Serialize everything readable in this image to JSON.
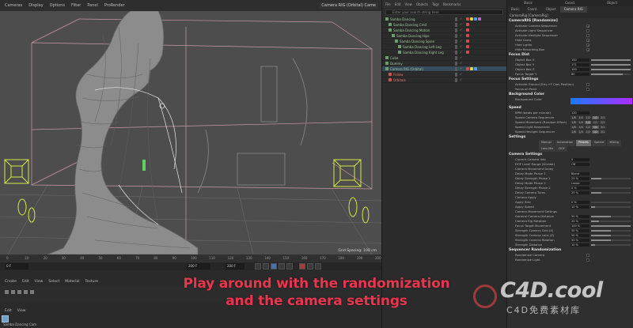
{
  "viewport": {
    "menus": [
      "Cameras",
      "Display",
      "Options",
      "Filter",
      "Panel",
      "ProRender"
    ],
    "camera_label": "Camera RIG (Orbital) Came",
    "footer": "Grid Spacing: 100 cm"
  },
  "timeline": {
    "ticks": [
      "0",
      "10",
      "20",
      "30",
      "40",
      "50",
      "60",
      "70",
      "80",
      "90",
      "100",
      "110",
      "120",
      "130",
      "140",
      "150",
      "160",
      "170",
      "180",
      "190",
      "200"
    ],
    "frame_start": "0 F",
    "frame_end": "200 F",
    "frame_total": "200 F",
    "material_menus": [
      "Create",
      "Edit",
      "View",
      "Select",
      "Material",
      "Texture"
    ],
    "attr_menus": [
      "Edit",
      "View"
    ],
    "material_name": "Samba Dancing Cam"
  },
  "object_manager": {
    "header": [
      "File",
      "Edit",
      "View",
      "Objects",
      "Tags",
      "Bookmarks"
    ],
    "search_placeholder": "Enter your search string here",
    "rows": [
      {
        "label": "Samba Dancing",
        "indent": 0,
        "selected": false,
        "red": false
      },
      {
        "label": "Samba Dancing Cmd",
        "indent": 1,
        "selected": false,
        "red": false
      },
      {
        "label": "Samba Dancing Motion",
        "indent": 1,
        "selected": false,
        "red": false
      },
      {
        "label": "Samba Dancing Hips",
        "indent": 2,
        "selected": false,
        "red": false
      },
      {
        "label": "Samba Dancing Spine",
        "indent": 3,
        "selected": false,
        "red": false
      },
      {
        "label": "Samba Dancing Left Leg",
        "indent": 4,
        "selected": false,
        "red": false
      },
      {
        "label": "Samba Dancing Right Leg",
        "indent": 4,
        "selected": false,
        "red": false
      },
      {
        "label": "Cube",
        "indent": 0,
        "selected": false,
        "red": false
      },
      {
        "label": "Dummy",
        "indent": 0,
        "selected": false,
        "red": false
      },
      {
        "label": "Camera RIG (Orbital)",
        "indent": 0,
        "selected": true,
        "red": false
      },
      {
        "label": "Follow",
        "indent": 1,
        "selected": false,
        "red": true
      },
      {
        "label": "Orbitals",
        "indent": 1,
        "selected": false,
        "red": true
      }
    ]
  },
  "attribute_manager": {
    "tabs": [
      "Basic",
      "Coord.",
      "Object"
    ],
    "tabs2": [
      "Basic",
      "Coord.",
      "Object",
      "Camera RIG"
    ],
    "object_name": "CameraRig [CameraRig]",
    "sections": {
      "randomize": "CameraRIG [Randomize]",
      "focus": "Focus Dist",
      "focus_settings": "Focus Settings",
      "background": "Background Color",
      "speed": "Speed",
      "settings": "Settings"
    },
    "randomize_rows": [
      {
        "k": "Activate Camera Sequencer",
        "check": "✓"
      },
      {
        "k": "Activate Light Sequencer",
        "check": ""
      },
      {
        "k": "Activate Hexlight Sequencer",
        "check": ""
      },
      {
        "k": "Hide Cams",
        "check": "✓"
      },
      {
        "k": "Hide Lights",
        "check": "✓"
      },
      {
        "k": "Hide Recording Box",
        "check": "✓"
      }
    ],
    "focus_rows": [
      {
        "k": "Object Box X",
        "v": "100"
      },
      {
        "k": "Object Box Y",
        "v": "171"
      },
      {
        "k": "Object Box Z",
        "v": "100"
      },
      {
        "k": "Focus Target Y",
        "v": "80"
      }
    ],
    "focus_settings_rows": [
      {
        "k": "Activate Ground (Env.+F Cam Position)",
        "check": ""
      },
      {
        "k": "Focus on Point",
        "check": ""
      }
    ],
    "background_label": "Background Color",
    "colors": {
      "bg_start": "#1a7bff",
      "bg_end": "#b02bff",
      "accent": "#e8364e"
    },
    "speed_rows": [
      {
        "k": "BPM (beats per minute)",
        "v": "120",
        "seg": []
      },
      {
        "k": "Speed Camera Sequencer",
        "v": "",
        "seg": [
          "1/8",
          "1/4",
          "1/2",
          "1/1",
          "2/1"
        ],
        "on": 3
      },
      {
        "k": "Speed Movement (Random Effect)",
        "v": "",
        "seg": [
          "1/8",
          "1/4",
          "1/2",
          "1/1",
          "2/1"
        ],
        "on": 2
      },
      {
        "k": "Speed Light Sequencer",
        "v": "",
        "seg": [
          "1/8",
          "1/4",
          "1/2",
          "1/1",
          "2/1"
        ],
        "on": 3
      },
      {
        "k": "Speed Hexlight Sequencer",
        "v": "",
        "seg": [
          "1/8",
          "1/4",
          "1/2",
          "1/1",
          "2/1"
        ],
        "on": 3
      }
    ],
    "settings_tabs": [
      "Manual",
      "Automation",
      "Presets",
      "Special",
      "Mixing"
    ],
    "settings_tabs2": [
      "Lens Mix",
      "DOF"
    ],
    "camera_settings_head": "Camera Settings",
    "camera_settings_rows": [
      {
        "k": "Current Camera Info",
        "v": "0"
      },
      {
        "k": "DOF Level Range (Divider)",
        "v": "Off"
      },
      {
        "k": "Camera Movement Delay",
        "v": ""
      },
      {
        "k": "Delay Mode Phase 1",
        "v": "Blend"
      },
      {
        "k": "Delay Strength Phase 1",
        "v": "25 %"
      },
      {
        "k": "Delay Mode Phase 2",
        "v": "Linear"
      },
      {
        "k": "Delay Strength Phase 2",
        "v": "0 %"
      },
      {
        "k": "Delay Camera Turns",
        "v": "25 %"
      },
      {
        "k": "Camera Apply",
        "v": ""
      },
      {
        "k": "Apply Size",
        "v": "0 %"
      },
      {
        "k": "Apply Speed",
        "v": "10 %"
      },
      {
        "k": "Camera Movement Settings",
        "v": ""
      },
      {
        "k": "General Camera Distance",
        "v": "50 %"
      },
      {
        "k": "Camera Rig Rotation",
        "v": "20 %"
      },
      {
        "k": "Focus Target Movement",
        "v": "100 %"
      },
      {
        "k": "Strength Camera Grid (X)",
        "v": "50 %"
      },
      {
        "k": "Strength Camera Lens (Z)",
        "v": "50 %"
      },
      {
        "k": "Strength Camera Rotation",
        "v": "50 %"
      },
      {
        "k": "Strength Distance",
        "v": "10 %"
      }
    ],
    "sequencer_head": "Sequencer Randomization",
    "sequencer_rows": [
      {
        "k": "Randomize Camera",
        "check": ""
      },
      {
        "k": "Randomize Light",
        "check": ""
      }
    ]
  },
  "subtitle": {
    "line1": "Play around with the randomization",
    "line2": "and the camera settings"
  },
  "watermark": {
    "logo": "C4D.cool",
    "tagline": "C4D免费素材库"
  }
}
